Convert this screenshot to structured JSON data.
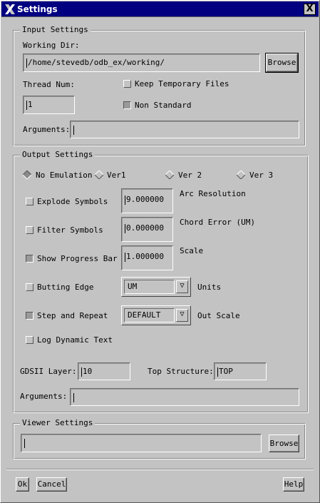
{
  "window": {
    "title": "Settings",
    "close_label": "X"
  },
  "input_settings": {
    "title": "Input Settings",
    "working_dir_label": "Working Dir:",
    "working_dir_value": "/home/stevedb/odb_ex/working/",
    "browse_label": "Browse",
    "thread_num_label": "Thread Num:",
    "thread_num_value": "1",
    "keep_temp_files_label": "Keep Temporary Files",
    "keep_temp_files_checked": false,
    "non_standard_label": "Non Standard",
    "non_standard_checked": true,
    "arguments_label": "Arguments:",
    "arguments_value": ""
  },
  "output_settings": {
    "title": "Output Settings",
    "emulation_options": [
      {
        "label": "No Emulation",
        "selected": true
      },
      {
        "label": "Ver1",
        "selected": false
      },
      {
        "label": "Ver 2",
        "selected": false
      },
      {
        "label": "Ver 3",
        "selected": false
      }
    ],
    "explode_symbols_label": "Explode Symbols",
    "explode_symbols_checked": false,
    "arc_resolution_value": "9.000000",
    "arc_resolution_label": "Arc Resolution",
    "filter_symbols_label": "Filter Symbols",
    "filter_symbols_checked": false,
    "chord_error_value": "0.000000",
    "chord_error_label": "Chord Error (UM)",
    "show_progress_label": "Show Progress Bar",
    "show_progress_checked": true,
    "scale_value": "1.000000",
    "scale_label": "Scale",
    "butting_edge_label": "Butting Edge",
    "butting_edge_checked": false,
    "units_value": "UM",
    "units_label": "Units",
    "step_repeat_label": "Step and Repeat",
    "step_repeat_checked": true,
    "out_scale_value": "DEFAULT",
    "out_scale_label": "Out Scale",
    "log_dynamic_label": "Log Dynamic Text",
    "log_dynamic_checked": false,
    "gdsii_layer_label": "GDSII Layer:",
    "gdsii_layer_value": "10",
    "top_structure_label": "Top Structure:",
    "top_structure_value": "TOP",
    "arguments_label": "Arguments:",
    "arguments_value": ""
  },
  "viewer_settings": {
    "title": "Viewer Settings",
    "path_value": "",
    "browse_label": "Browse"
  },
  "footer": {
    "ok_label": "Ok",
    "cancel_label": "Cancel",
    "help_label": "Help"
  },
  "icons": {
    "app_logo": "x-logo-icon",
    "dropdown_arrow": "triangle-down-icon"
  }
}
